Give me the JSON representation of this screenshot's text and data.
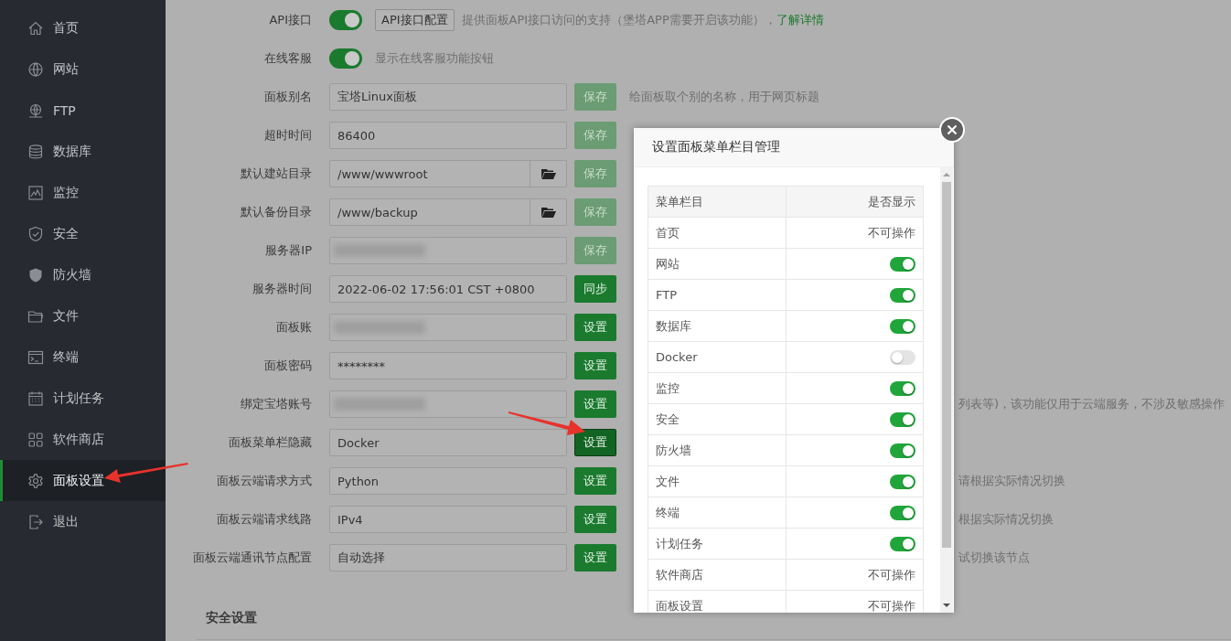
{
  "sidebar": {
    "items": [
      {
        "label": "首页",
        "selected": false
      },
      {
        "label": "网站",
        "selected": false
      },
      {
        "label": "FTP",
        "selected": false
      },
      {
        "label": "数据库",
        "selected": false
      },
      {
        "label": "监控",
        "selected": false
      },
      {
        "label": "安全",
        "selected": false
      },
      {
        "label": "防火墙",
        "selected": false
      },
      {
        "label": "文件",
        "selected": false
      },
      {
        "label": "终端",
        "selected": false
      },
      {
        "label": "计划任务",
        "selected": false
      },
      {
        "label": "软件商店",
        "selected": false
      },
      {
        "label": "面板设置",
        "selected": true
      },
      {
        "label": "退出",
        "selected": false
      }
    ]
  },
  "settings": {
    "rows": [
      {
        "kind": "toggle",
        "label": "API接口",
        "on": true,
        "extra_button": "API接口配置",
        "description": "提供面板API接口访问的支持（堡塔APP需要开启该功能），",
        "link": "了解详情"
      },
      {
        "kind": "toggle",
        "label": "在线客服",
        "on": true,
        "description": "显示在线客服功能按钮"
      },
      {
        "kind": "text",
        "label": "面板别名",
        "value": "宝塔Linux面板",
        "button": {
          "label": "保存",
          "disabled": true,
          "active": false
        },
        "description": "给面板取个别的名称，用于网页标题"
      },
      {
        "kind": "text",
        "label": "超时时间",
        "value": "86400",
        "button": {
          "label": "保存",
          "disabled": true,
          "active": false
        }
      },
      {
        "kind": "path",
        "label": "默认建站目录",
        "value": "/www/wwwroot",
        "button": {
          "label": "保存",
          "disabled": true,
          "active": false
        }
      },
      {
        "kind": "path",
        "label": "默认备份目录",
        "value": "/www/backup",
        "button": {
          "label": "保存",
          "disabled": true,
          "active": false
        }
      },
      {
        "kind": "redacted",
        "label": "服务器IP",
        "button": {
          "label": "保存",
          "disabled": true,
          "active": false
        }
      },
      {
        "kind": "text",
        "label": "服务器时间",
        "value": "2022-06-02 17:56:01 CST +0800",
        "button": {
          "label": "同步",
          "disabled": false,
          "active": false
        }
      },
      {
        "kind": "redacted",
        "label": "面板账",
        "button": {
          "label": "设置",
          "disabled": false,
          "active": false
        }
      },
      {
        "kind": "text",
        "label": "面板密码",
        "value": "********",
        "button": {
          "label": "设置",
          "disabled": false,
          "active": false
        }
      },
      {
        "kind": "redacted",
        "label": "绑定宝塔账号",
        "button": {
          "label": "设置",
          "disabled": false,
          "active": false
        },
        "description_tail": "列表等)，该功能仅用于云端服务，不涉及敏感操作"
      },
      {
        "kind": "text",
        "label": "面板菜单栏隐藏",
        "value": "Docker",
        "button": {
          "label": "设置",
          "disabled": false,
          "active": true
        }
      },
      {
        "kind": "text",
        "label": "面板云端请求方式",
        "value": "Python",
        "button": {
          "label": "设置",
          "disabled": false,
          "active": false
        },
        "description_tail": "请根据实际情况切换"
      },
      {
        "kind": "text",
        "label": "面板云端请求线路",
        "value": "IPv4",
        "button": {
          "label": "设置",
          "disabled": false,
          "active": false
        },
        "description_tail": "根据实际情况切换"
      },
      {
        "kind": "text",
        "label": "面板云端通讯节点配置",
        "value": "自动选择",
        "button": {
          "label": "设置",
          "disabled": false,
          "active": false
        },
        "description_tail": "试切换该节点"
      }
    ],
    "section_title": "安全设置"
  },
  "dialog": {
    "title": "设置面板菜单栏目管理",
    "columns": [
      "菜单栏目",
      "是否显示"
    ],
    "rows": [
      {
        "name": "首页",
        "kind": "fixed",
        "status": "不可操作"
      },
      {
        "name": "网站",
        "kind": "toggle",
        "on": true
      },
      {
        "name": "FTP",
        "kind": "toggle",
        "on": true
      },
      {
        "name": "数据库",
        "kind": "toggle",
        "on": true
      },
      {
        "name": "Docker",
        "kind": "toggle",
        "on": false
      },
      {
        "name": "监控",
        "kind": "toggle",
        "on": true
      },
      {
        "name": "安全",
        "kind": "toggle",
        "on": true
      },
      {
        "name": "防火墙",
        "kind": "toggle",
        "on": true
      },
      {
        "name": "文件",
        "kind": "toggle",
        "on": true
      },
      {
        "name": "终端",
        "kind": "toggle",
        "on": true
      },
      {
        "name": "计划任务",
        "kind": "toggle",
        "on": true
      },
      {
        "name": "软件商店",
        "kind": "fixed",
        "status": "不可操作"
      },
      {
        "name": "面板设置",
        "kind": "fixed",
        "status": "不可操作"
      }
    ]
  }
}
